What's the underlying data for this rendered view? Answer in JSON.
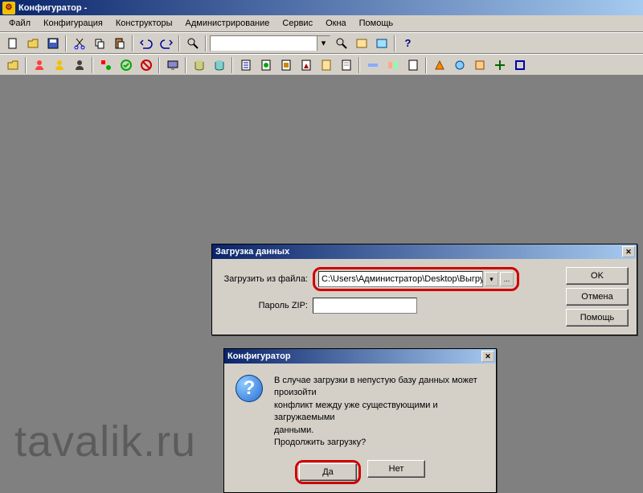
{
  "app": {
    "title": "Конфигуратор -"
  },
  "menu": {
    "file": "Файл",
    "config": "Конфигурация",
    "constructors": "Конструкторы",
    "admin": "Администрирование",
    "service": "Сервис",
    "windows": "Окна",
    "help": "Помощь"
  },
  "dialog_load": {
    "title": "Загрузка данных",
    "label_file": "Загрузить из файла:",
    "file_value": "C:\\Users\\Администратор\\Desktop\\Выгруз",
    "label_zip": "Пароль ZIP:",
    "zip_value": "",
    "ok": "OK",
    "cancel": "Отмена",
    "help": "Помощь",
    "browse": "..."
  },
  "dialog_confirm": {
    "title": "Конфигуратор",
    "message_l1": "В случае загрузки в непустую базу данных может произойти",
    "message_l2": "конфликт между уже существующими и загружаемыми",
    "message_l3": "данными.",
    "message_l4": "Продолжить загрузку?",
    "yes": "Да",
    "no": "Нет"
  },
  "watermark": "tavalik.ru"
}
